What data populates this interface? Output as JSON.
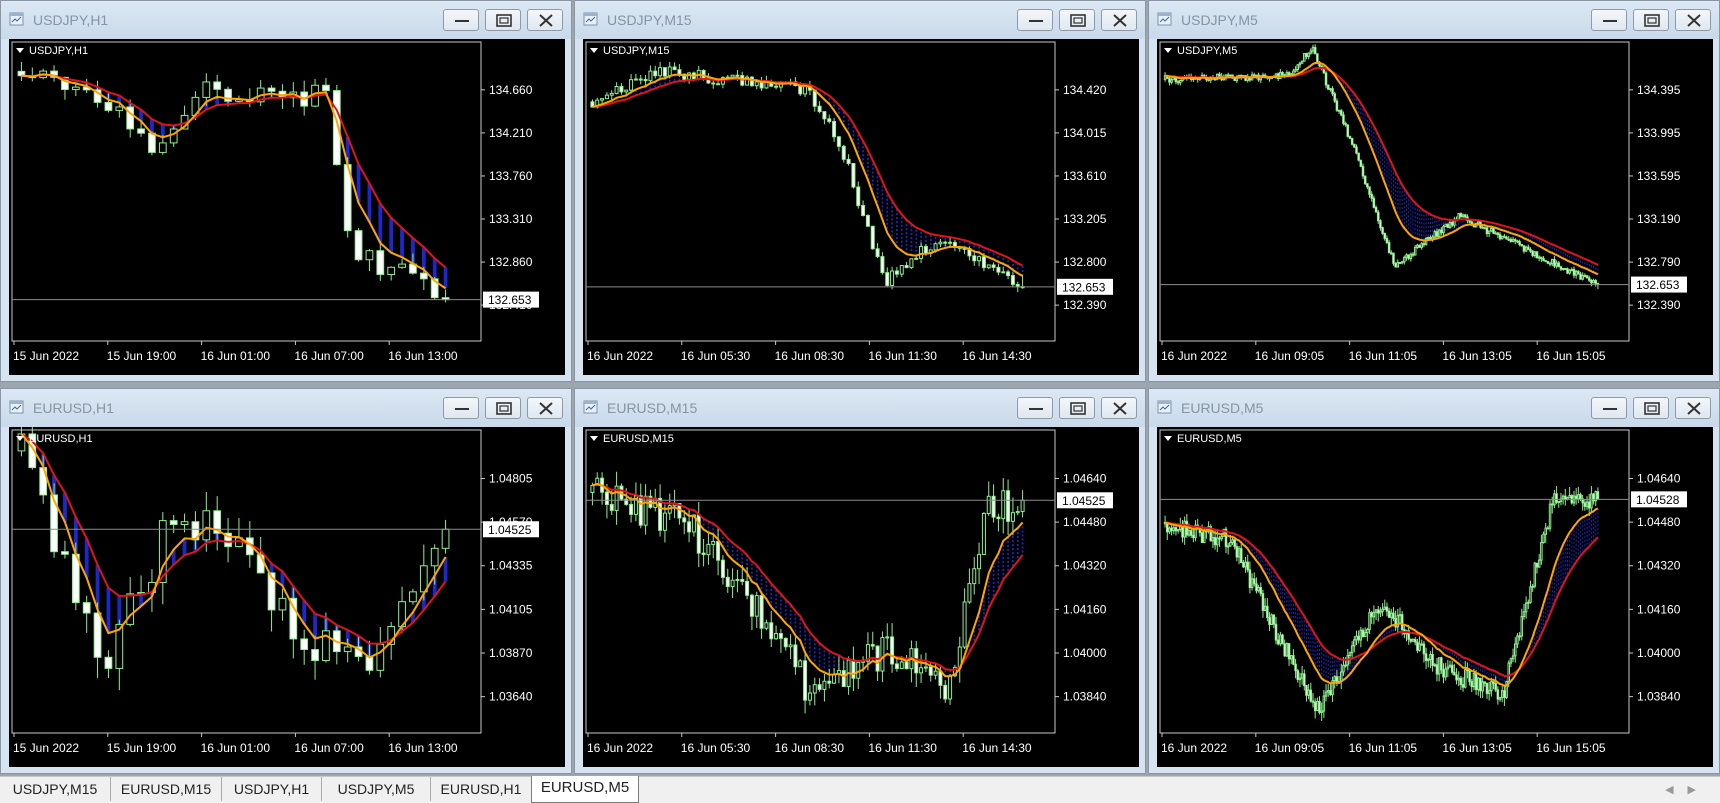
{
  "colors": {
    "ema_fast": "#ffa500",
    "ema_slow": "#e0141c",
    "bull": "#90ee90",
    "bear": "#ffffff",
    "fill": "#1e28c8"
  },
  "windows": [
    {
      "title": "USDJPY,H1",
      "label": "USDJPY,H1",
      "price": "132.653",
      "yticks": [
        "134.660",
        "134.210",
        "133.760",
        "133.310",
        "132.860",
        "132.410"
      ],
      "xticks": [
        "15 Jun 2022",
        "15 Jun 19:00",
        "16 Jun 01:00",
        "16 Jun 07:00",
        "16 Jun 13:00"
      ]
    },
    {
      "title": "USDJPY,M15",
      "label": "USDJPY,M15",
      "price": "132.653",
      "yticks": [
        "134.420",
        "134.015",
        "133.610",
        "133.205",
        "132.800",
        "132.390"
      ],
      "xticks": [
        "16 Jun 2022",
        "16 Jun 05:30",
        "16 Jun 08:30",
        "16 Jun 11:30",
        "16 Jun 14:30"
      ]
    },
    {
      "title": "USDJPY,M5",
      "label": "USDJPY,M5",
      "price": "132.653",
      "yticks": [
        "134.395",
        "133.995",
        "133.595",
        "133.190",
        "132.790",
        "132.390"
      ],
      "xticks": [
        "16 Jun 2022",
        "16 Jun 09:05",
        "16 Jun 11:05",
        "16 Jun 13:05",
        "16 Jun 15:05"
      ]
    },
    {
      "title": "EURUSD,H1",
      "label": "EURUSD,H1",
      "price": "1.04525",
      "yticks": [
        "1.04805",
        "1.04570",
        "1.04335",
        "1.04105",
        "1.03870",
        "1.03640"
      ],
      "xticks": [
        "15 Jun 2022",
        "15 Jun 19:00",
        "16 Jun 01:00",
        "16 Jun 07:00",
        "16 Jun 13:00"
      ]
    },
    {
      "title": "EURUSD,M15",
      "label": "EURUSD,M15",
      "price": "1.04525",
      "yticks": [
        "1.04640",
        "1.04480",
        "1.04320",
        "1.04160",
        "1.04000",
        "1.03840"
      ],
      "xticks": [
        "16 Jun 2022",
        "16 Jun 05:30",
        "16 Jun 08:30",
        "16 Jun 11:30",
        "16 Jun 14:30"
      ]
    },
    {
      "title": "EURUSD,M5",
      "label": "EURUSD,M5",
      "price": "1.04528",
      "yticks": [
        "1.04640",
        "1.04480",
        "1.04320",
        "1.04160",
        "1.04000",
        "1.03840"
      ],
      "xticks": [
        "16 Jun 2022",
        "16 Jun 09:05",
        "16 Jun 11:05",
        "16 Jun 13:05",
        "16 Jun 15:05"
      ]
    }
  ],
  "chart_data": [
    {
      "type": "candlestick",
      "title": "USDJPY,H1",
      "count": 40,
      "start": 134.6,
      "path": [
        [
          0,
          134.62
        ],
        [
          0.2,
          134.4
        ],
        [
          0.3,
          133.95
        ],
        [
          0.42,
          134.45
        ],
        [
          0.72,
          134.4
        ],
        [
          0.78,
          133.1
        ],
        [
          1.0,
          132.65
        ]
      ],
      "vol": 0.14,
      "ema_fast_end": 133.55,
      "ema_slow_end": 133.92,
      "ylim": [
        132.3,
        134.85
      ],
      "last": 132.653
    },
    {
      "type": "candlestick",
      "title": "USDJPY,M15",
      "count": 90,
      "start": 134.2,
      "path": [
        [
          0,
          134.2
        ],
        [
          0.15,
          134.45
        ],
        [
          0.5,
          134.3
        ],
        [
          0.58,
          133.8
        ],
        [
          0.68,
          132.7
        ],
        [
          0.8,
          133.05
        ],
        [
          1.0,
          132.65
        ]
      ],
      "vol": 0.07,
      "ema_fast_end": 133.0,
      "ema_slow_end": 133.32,
      "ylim": [
        132.2,
        134.7
      ],
      "last": 132.653
    },
    {
      "type": "candlestick",
      "title": "USDJPY,M5",
      "count": 200,
      "start": 134.3,
      "path": [
        [
          0,
          134.3
        ],
        [
          0.28,
          134.33
        ],
        [
          0.34,
          134.55
        ],
        [
          0.43,
          133.8
        ],
        [
          0.53,
          132.8
        ],
        [
          0.68,
          133.2
        ],
        [
          1.0,
          132.65
        ]
      ],
      "vol": 0.04,
      "ema_fast_end": 132.7,
      "ema_slow_end": 132.82,
      "ylim": [
        132.2,
        134.6
      ],
      "last": 132.653
    },
    {
      "type": "candlestick",
      "title": "EURUSD,H1",
      "count": 40,
      "start": 1.049,
      "path": [
        [
          0,
          1.049
        ],
        [
          0.12,
          1.042
        ],
        [
          0.2,
          1.0385
        ],
        [
          0.35,
          1.046
        ],
        [
          0.5,
          1.0445
        ],
        [
          0.68,
          1.0395
        ],
        [
          0.85,
          1.039
        ],
        [
          1.0,
          1.0452
        ]
      ],
      "vol": 0.0015,
      "ema_fast_end": 1.0428,
      "ema_slow_end": 1.0432,
      "ylim": [
        1.0355,
        1.05
      ],
      "last": 1.04525
    },
    {
      "type": "candlestick",
      "title": "EURUSD,M15",
      "count": 90,
      "start": 1.0455,
      "path": [
        [
          0,
          1.0455
        ],
        [
          0.22,
          1.0445
        ],
        [
          0.35,
          1.0425
        ],
        [
          0.5,
          1.0392
        ],
        [
          0.7,
          1.0405
        ],
        [
          0.82,
          1.039
        ],
        [
          0.92,
          1.045
        ],
        [
          1.0,
          1.0452
        ]
      ],
      "vol": 0.0007,
      "ema_fast_end": 1.0423,
      "ema_slow_end": 1.0421,
      "ylim": [
        1.0378,
        1.0475
      ],
      "last": 1.04525
    },
    {
      "type": "candlestick",
      "title": "EURUSD,M5",
      "count": 200,
      "start": 1.0445,
      "path": [
        [
          0,
          1.0445
        ],
        [
          0.15,
          1.044
        ],
        [
          0.35,
          1.0385
        ],
        [
          0.5,
          1.042
        ],
        [
          0.62,
          1.04
        ],
        [
          0.78,
          1.039
        ],
        [
          0.9,
          1.0455
        ],
        [
          1.0,
          1.0452
        ]
      ],
      "vol": 0.0004,
      "ema_fast_end": 1.0438,
      "ema_slow_end": 1.0433,
      "ylim": [
        1.0378,
        1.0475
      ],
      "last": 1.04528
    }
  ],
  "tabs": [
    "USDJPY,M15",
    "EURUSD,M15",
    "USDJPY,H1",
    "USDJPY,M5",
    "EURUSD,H1",
    "EURUSD,M5"
  ],
  "active_tab": "EURUSD,M5"
}
